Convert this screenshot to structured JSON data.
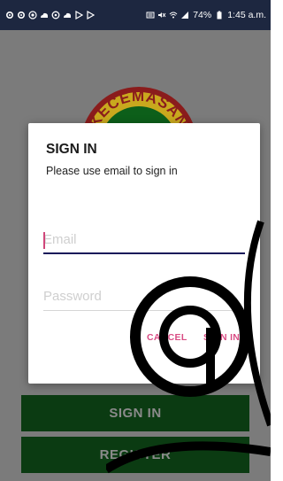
{
  "status_bar": {
    "battery": "74%",
    "time": "1:45 a.m.",
    "left_icons": [
      "gear-icon",
      "gear-icon",
      "browser-icon",
      "cloud-icon",
      "circle-icon",
      "cloud-icon",
      "play-store-icon",
      "play-store-icon"
    ],
    "right_icons": [
      "signal-box-icon",
      "mute-icon",
      "wifi-icon",
      "cell-signal-icon",
      "battery-icon"
    ]
  },
  "logo": {
    "text": "KECEMASAN"
  },
  "dialog": {
    "title": "SIGN IN",
    "subtitle": "Please use email to sign in",
    "email_placeholder": "Email",
    "password_placeholder": "Password",
    "cancel_label": "CANCEL",
    "signin_label": "SIGN IN"
  },
  "app": {
    "signin_label": "SIGN IN",
    "register_label": "REGISTER"
  },
  "colors": {
    "status_bar": "#1d2740",
    "accent": "#d94c84",
    "app_button": "#0b3b12",
    "overlay": "#7b7b7b"
  }
}
